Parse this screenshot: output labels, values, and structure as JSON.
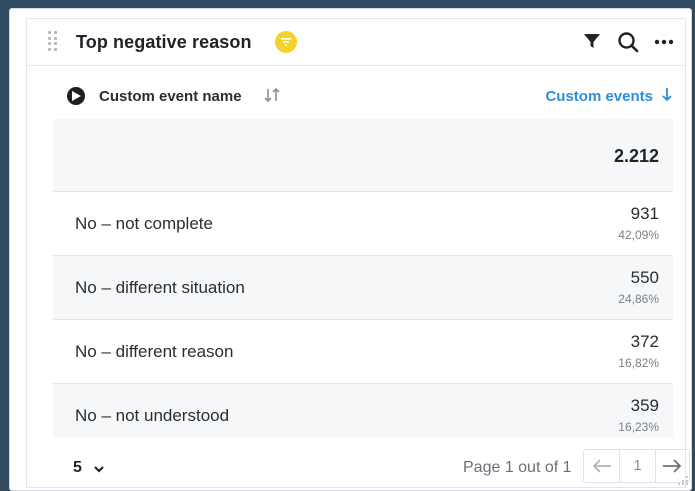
{
  "widget": {
    "title": "Top negative reason"
  },
  "columns": {
    "dimension": "Custom event name",
    "metric": "Custom events"
  },
  "total": "2.212",
  "rows": [
    {
      "label": "No – not complete",
      "value": "931",
      "percent": "42,09%"
    },
    {
      "label": "No – different situation",
      "value": "550",
      "percent": "24,86%"
    },
    {
      "label": "No – different reason",
      "value": "372",
      "percent": "16,82%"
    },
    {
      "label": "No – not understood",
      "value": "359",
      "percent": "16,23%"
    }
  ],
  "footer": {
    "page_size": "5",
    "page_info": "Page 1 out of 1",
    "current_page": "1"
  },
  "colors": {
    "filter_badge": "#f5d12b",
    "metric_accent": "#2d8fd9",
    "page_background": "#2f4a5e"
  },
  "icons": [
    "drag-handle-icon",
    "filter-badge-icon",
    "filter-icon",
    "search-icon",
    "more-icon",
    "play-icon",
    "sort-icon",
    "sort-down-icon",
    "chevron-down-icon",
    "arrow-left-icon",
    "arrow-right-icon",
    "resize-icon"
  ]
}
